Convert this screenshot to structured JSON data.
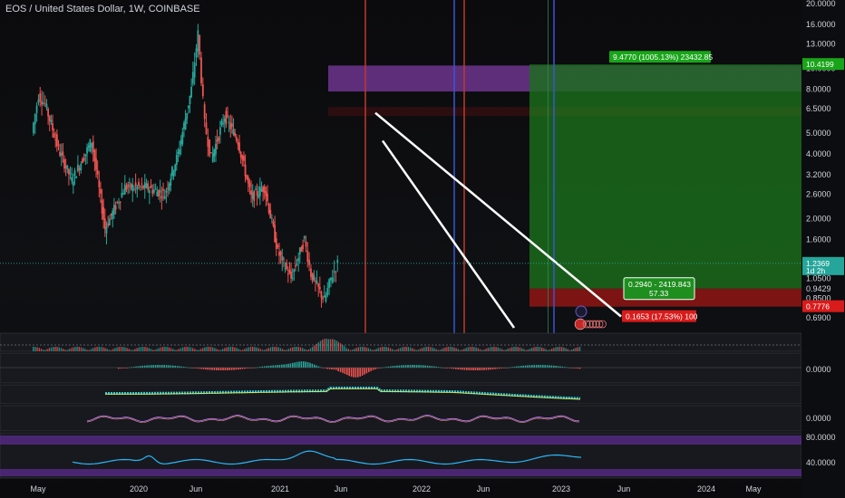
{
  "header": {
    "title": "EOS / United States Dollar, 1W, COINBASE"
  },
  "colors": {
    "up": "#26a69a",
    "down": "#ef5350",
    "profit_zone": "#1f8f1f",
    "loss_zone": "#8f1515",
    "magenta_zone": "#a24ad6",
    "vline_red": "#c0392b",
    "vline_blue": "#3a55d6",
    "vline_green": "#2e8b57",
    "trendline": "#ffffff",
    "badge_green": "#19a519",
    "badge_red": "#d81b1b",
    "rsi_line": "#29b6f6",
    "rsi_band": "#5b2b8f"
  },
  "chart_data": {
    "type": "candlestick",
    "symbol": "EOS / United States Dollar",
    "interval": "1W",
    "exchange": "COINBASE",
    "y_scale": "log",
    "ylim": [
      0.62,
      20
    ],
    "y_ticks": [
      "20.0000",
      "16.0000",
      "13.0000",
      "10.0000",
      "8.0000",
      "6.5000",
      "5.0000",
      "4.0000",
      "3.2000",
      "2.6000",
      "2.0000",
      "1.6000",
      "1.2000",
      "1.0500",
      "0.9429",
      "0.8500",
      "0.6900"
    ],
    "x_ticks": [
      "May",
      "2020",
      "Jun",
      "2021",
      "Jun",
      "2022",
      "Jun",
      "2023",
      "Jun",
      "2024",
      "May"
    ],
    "price_path": [
      {
        "t": "2019-04",
        "close": 5.0
      },
      {
        "t": "2019-05",
        "close": 7.5
      },
      {
        "t": "2019-06",
        "close": 6.8
      },
      {
        "t": "2019-08",
        "close": 4.2
      },
      {
        "t": "2019-10",
        "close": 3.0
      },
      {
        "t": "2020-01",
        "close": 4.6
      },
      {
        "t": "2020-03",
        "close": 1.8
      },
      {
        "t": "2020-06",
        "close": 2.8
      },
      {
        "t": "2020-09",
        "close": 2.8
      },
      {
        "t": "2020-12",
        "close": 2.6
      },
      {
        "t": "2021-02",
        "close": 4.0
      },
      {
        "t": "2021-04",
        "close": 8.0
      },
      {
        "t": "2021-05",
        "close": 14.5
      },
      {
        "t": "2021-06",
        "close": 5.5
      },
      {
        "t": "2021-07",
        "close": 3.8
      },
      {
        "t": "2021-09",
        "close": 6.0
      },
      {
        "t": "2021-11",
        "close": 4.6
      },
      {
        "t": "2022-01",
        "close": 2.5
      },
      {
        "t": "2022-03",
        "close": 2.8
      },
      {
        "t": "2022-05",
        "close": 1.4
      },
      {
        "t": "2022-07",
        "close": 1.05
      },
      {
        "t": "2022-09",
        "close": 1.6
      },
      {
        "t": "2022-10",
        "close": 1.1
      },
      {
        "t": "2022-12",
        "close": 0.83
      },
      {
        "t": "2023-01",
        "close": 1.05
      },
      {
        "t": "2023-02",
        "close": 1.2369
      }
    ],
    "last_price": "1.2369",
    "last_price_timer": "1d 2h",
    "position": {
      "entry": 0.9429,
      "target": 10.4199,
      "stop": 0.7776,
      "target_label": "10.4199",
      "stop_label": "0.7776",
      "profit_text": "9.4770 (1005.13%) 23432.85",
      "loss_text": "0.1653 (17.53%) 100",
      "entry_text_1": "0.2940 - 2419.843",
      "entry_text_2": "57.33"
    },
    "indicators": {
      "panel2_value": "0.0000",
      "panel4_value": "0.0000",
      "rsi_upper": "80.0000",
      "rsi_lower": "40.0000"
    }
  }
}
